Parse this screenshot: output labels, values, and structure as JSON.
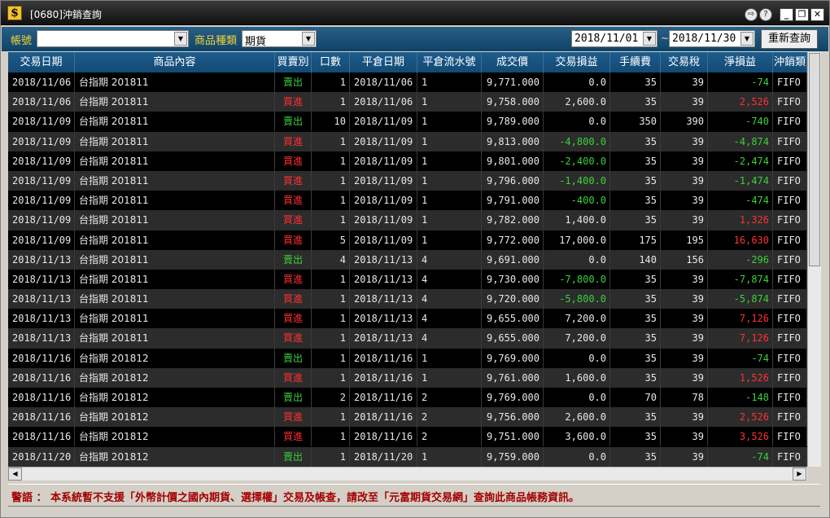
{
  "window": {
    "title": "[0680]沖銷查詢",
    "app_icon": "$",
    "controls": [
      "⇨",
      "?",
      "_",
      "❐",
      "✕"
    ]
  },
  "toolbar": {
    "account_label": "帳號",
    "account_value": "",
    "product_type_label": "商品種類",
    "product_type_value": "期貨",
    "date_from": "2018/11/01",
    "date_separator": "~",
    "date_to": "2018/11/30",
    "requery_button": "重新查詢"
  },
  "table": {
    "headers": [
      "交易日期",
      "商品內容",
      "買賣別",
      "口數",
      "平倉日期",
      "平倉流水號",
      "成交價",
      "交易損益",
      "手續費",
      "交易稅",
      "淨損益",
      "沖銷類"
    ],
    "rows": [
      {
        "trade_date": "2018/11/06",
        "product": "台指期  201811",
        "side": "賣出",
        "qty": "1",
        "close_date": "2018/11/06",
        "serial": "1",
        "price": "9,771.000",
        "trade_pl": "0.0",
        "fee": "35",
        "tax": "39",
        "net_pl": "-74",
        "method": "FIFO"
      },
      {
        "trade_date": "2018/11/06",
        "product": "台指期  201811",
        "side": "買進",
        "qty": "1",
        "close_date": "2018/11/06",
        "serial": "1",
        "price": "9,758.000",
        "trade_pl": "2,600.0",
        "fee": "35",
        "tax": "39",
        "net_pl": "2,526",
        "method": "FIFO"
      },
      {
        "trade_date": "2018/11/09",
        "product": "台指期  201811",
        "side": "賣出",
        "qty": "10",
        "close_date": "2018/11/09",
        "serial": "1",
        "price": "9,789.000",
        "trade_pl": "0.0",
        "fee": "350",
        "tax": "390",
        "net_pl": "-740",
        "method": "FIFO"
      },
      {
        "trade_date": "2018/11/09",
        "product": "台指期  201811",
        "side": "買進",
        "qty": "1",
        "close_date": "2018/11/09",
        "serial": "1",
        "price": "9,813.000",
        "trade_pl": "-4,800.0",
        "fee": "35",
        "tax": "39",
        "net_pl": "-4,874",
        "method": "FIFO"
      },
      {
        "trade_date": "2018/11/09",
        "product": "台指期  201811",
        "side": "買進",
        "qty": "1",
        "close_date": "2018/11/09",
        "serial": "1",
        "price": "9,801.000",
        "trade_pl": "-2,400.0",
        "fee": "35",
        "tax": "39",
        "net_pl": "-2,474",
        "method": "FIFO"
      },
      {
        "trade_date": "2018/11/09",
        "product": "台指期  201811",
        "side": "買進",
        "qty": "1",
        "close_date": "2018/11/09",
        "serial": "1",
        "price": "9,796.000",
        "trade_pl": "-1,400.0",
        "fee": "35",
        "tax": "39",
        "net_pl": "-1,474",
        "method": "FIFO"
      },
      {
        "trade_date": "2018/11/09",
        "product": "台指期  201811",
        "side": "買進",
        "qty": "1",
        "close_date": "2018/11/09",
        "serial": "1",
        "price": "9,791.000",
        "trade_pl": "-400.0",
        "fee": "35",
        "tax": "39",
        "net_pl": "-474",
        "method": "FIFO"
      },
      {
        "trade_date": "2018/11/09",
        "product": "台指期  201811",
        "side": "買進",
        "qty": "1",
        "close_date": "2018/11/09",
        "serial": "1",
        "price": "9,782.000",
        "trade_pl": "1,400.0",
        "fee": "35",
        "tax": "39",
        "net_pl": "1,326",
        "method": "FIFO"
      },
      {
        "trade_date": "2018/11/09",
        "product": "台指期  201811",
        "side": "買進",
        "qty": "5",
        "close_date": "2018/11/09",
        "serial": "1",
        "price": "9,772.000",
        "trade_pl": "17,000.0",
        "fee": "175",
        "tax": "195",
        "net_pl": "16,630",
        "method": "FIFO"
      },
      {
        "trade_date": "2018/11/13",
        "product": "台指期  201811",
        "side": "賣出",
        "qty": "4",
        "close_date": "2018/11/13",
        "serial": "4",
        "price": "9,691.000",
        "trade_pl": "0.0",
        "fee": "140",
        "tax": "156",
        "net_pl": "-296",
        "method": "FIFO"
      },
      {
        "trade_date": "2018/11/13",
        "product": "台指期  201811",
        "side": "買進",
        "qty": "1",
        "close_date": "2018/11/13",
        "serial": "4",
        "price": "9,730.000",
        "trade_pl": "-7,800.0",
        "fee": "35",
        "tax": "39",
        "net_pl": "-7,874",
        "method": "FIFO"
      },
      {
        "trade_date": "2018/11/13",
        "product": "台指期  201811",
        "side": "買進",
        "qty": "1",
        "close_date": "2018/11/13",
        "serial": "4",
        "price": "9,720.000",
        "trade_pl": "-5,800.0",
        "fee": "35",
        "tax": "39",
        "net_pl": "-5,874",
        "method": "FIFO"
      },
      {
        "trade_date": "2018/11/13",
        "product": "台指期  201811",
        "side": "買進",
        "qty": "1",
        "close_date": "2018/11/13",
        "serial": "4",
        "price": "9,655.000",
        "trade_pl": "7,200.0",
        "fee": "35",
        "tax": "39",
        "net_pl": "7,126",
        "method": "FIFO"
      },
      {
        "trade_date": "2018/11/13",
        "product": "台指期  201811",
        "side": "買進",
        "qty": "1",
        "close_date": "2018/11/13",
        "serial": "4",
        "price": "9,655.000",
        "trade_pl": "7,200.0",
        "fee": "35",
        "tax": "39",
        "net_pl": "7,126",
        "method": "FIFO"
      },
      {
        "trade_date": "2018/11/16",
        "product": "台指期  201812",
        "side": "賣出",
        "qty": "1",
        "close_date": "2018/11/16",
        "serial": "1",
        "price": "9,769.000",
        "trade_pl": "0.0",
        "fee": "35",
        "tax": "39",
        "net_pl": "-74",
        "method": "FIFO"
      },
      {
        "trade_date": "2018/11/16",
        "product": "台指期  201812",
        "side": "買進",
        "qty": "1",
        "close_date": "2018/11/16",
        "serial": "1",
        "price": "9,761.000",
        "trade_pl": "1,600.0",
        "fee": "35",
        "tax": "39",
        "net_pl": "1,526",
        "method": "FIFO"
      },
      {
        "trade_date": "2018/11/16",
        "product": "台指期  201812",
        "side": "賣出",
        "qty": "2",
        "close_date": "2018/11/16",
        "serial": "2",
        "price": "9,769.000",
        "trade_pl": "0.0",
        "fee": "70",
        "tax": "78",
        "net_pl": "-148",
        "method": "FIFO"
      },
      {
        "trade_date": "2018/11/16",
        "product": "台指期  201812",
        "side": "買進",
        "qty": "1",
        "close_date": "2018/11/16",
        "serial": "2",
        "price": "9,756.000",
        "trade_pl": "2,600.0",
        "fee": "35",
        "tax": "39",
        "net_pl": "2,526",
        "method": "FIFO"
      },
      {
        "trade_date": "2018/11/16",
        "product": "台指期  201812",
        "side": "買進",
        "qty": "1",
        "close_date": "2018/11/16",
        "serial": "2",
        "price": "9,751.000",
        "trade_pl": "3,600.0",
        "fee": "35",
        "tax": "39",
        "net_pl": "3,526",
        "method": "FIFO"
      },
      {
        "trade_date": "2018/11/20",
        "product": "台指期  201812",
        "side": "賣出",
        "qty": "1",
        "close_date": "2018/11/20",
        "serial": "1",
        "price": "9,759.000",
        "trade_pl": "0.0",
        "fee": "35",
        "tax": "39",
        "net_pl": "-74",
        "method": "FIFO"
      }
    ]
  },
  "warning": "警語 ： 本系統暫不支援「外幣計價之國內期貨、選擇權」交易及帳查，請改至「元富期貨交易網」查詢此商品帳務資訊。",
  "colors": {
    "sell": "#39d13a",
    "buy": "#ff3030",
    "label": "#f4d23a",
    "warning": "#a40000"
  }
}
